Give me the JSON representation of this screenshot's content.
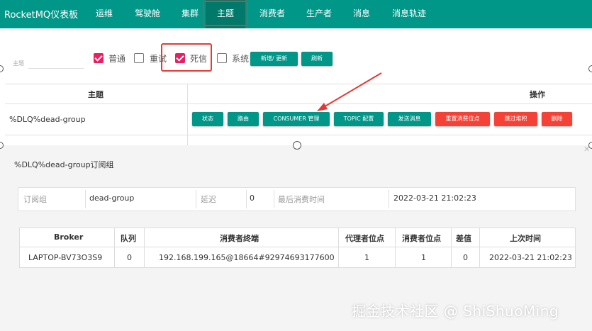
{
  "app": {
    "title": "RocketMQ仪表板"
  },
  "nav": {
    "items": [
      "运维",
      "驾驶舱",
      "集群",
      "主题",
      "消费者",
      "生产者",
      "消息",
      "消息轨迹"
    ],
    "active": "主题"
  },
  "filter": {
    "topic_label": "主题",
    "checkboxes": [
      {
        "label": "普通",
        "checked": true
      },
      {
        "label": "重试",
        "checked": false
      },
      {
        "label": "死信",
        "checked": true
      },
      {
        "label": "系统",
        "checked": false
      }
    ],
    "add_update_label": "新增/ 更新",
    "refresh_label": "刷新"
  },
  "table": {
    "headers": {
      "topic": "主题",
      "operation": "操作"
    },
    "rows": [
      {
        "topic": "%DLQ%dead-group",
        "actions": [
          "状态",
          "路由",
          "CONSUMER 管理",
          "TOPIC 配置",
          "发送消息",
          "重置消费位点",
          "跳过堆积",
          "删除"
        ]
      }
    ]
  },
  "dialog": {
    "title": "%DLQ%dead-group订阅组",
    "info": {
      "group_label": "订阅组",
      "group_value": "dead-group",
      "delay_label": "延迟",
      "delay_value": "0",
      "last_label": "最后消费时间",
      "last_value": "2022-03-21 21:02:23"
    },
    "sub_table": {
      "headers": [
        "Broker",
        "队列",
        "消费者终端",
        "代理者位点",
        "消费者位点",
        "差值",
        "上次时间"
      ],
      "row": [
        "LAPTOP-BV73O3S9",
        "0",
        "192.168.199.165@18664#92974693177600",
        "1",
        "1",
        "0",
        "2022-03-21 21:02:23"
      ]
    }
  },
  "watermark": "掘金技术社区 @ ShiShuoMing",
  "colors": {
    "primary": "#009688",
    "danger": "#f44336",
    "checkbox": "#e91e63",
    "highlight": "#e53935"
  }
}
